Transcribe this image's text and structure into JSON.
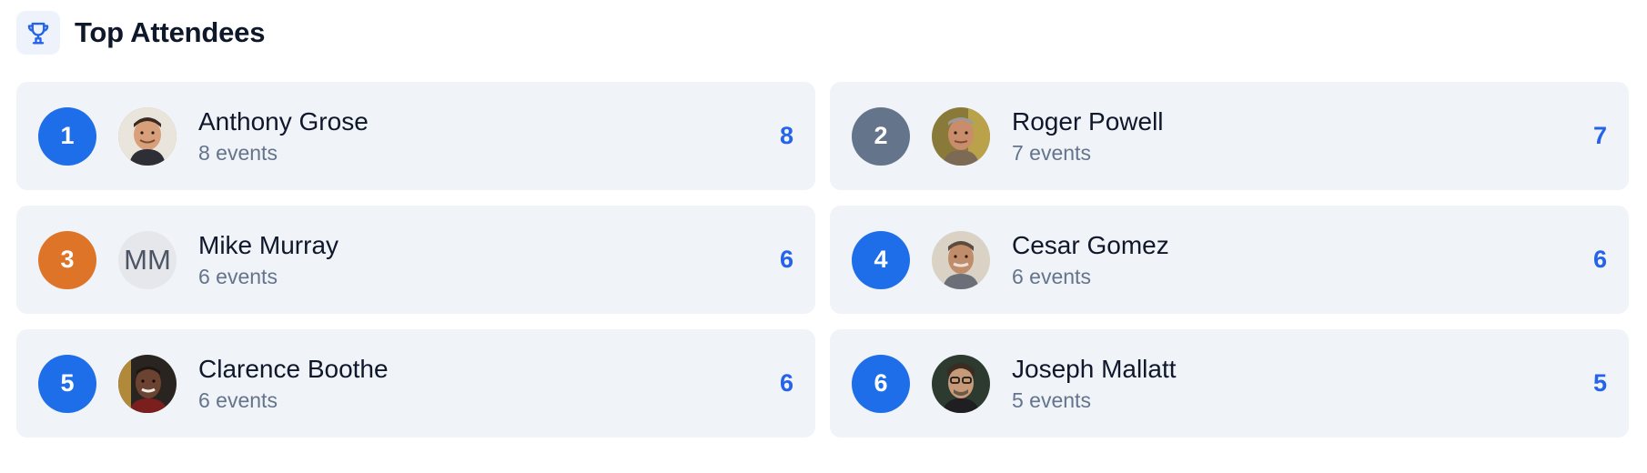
{
  "header": {
    "title": "Top Attendees",
    "icon": "trophy-icon"
  },
  "colors": {
    "accent": "#2563eb",
    "rank_default": "#1d6ee8",
    "rank_second": "#64748b",
    "rank_third": "#dd7427",
    "card_bg": "#f0f3f8"
  },
  "attendees": [
    {
      "rank": "1",
      "name": "Anthony Grose",
      "events": "8 events",
      "count": "8",
      "avatar": "photo",
      "rank_color": "#1d6ee8"
    },
    {
      "rank": "2",
      "name": "Roger Powell",
      "events": "7 events",
      "count": "7",
      "avatar": "photo",
      "rank_color": "#64748b"
    },
    {
      "rank": "3",
      "name": "Mike Murray",
      "events": "6 events",
      "count": "6",
      "avatar": "initials",
      "initials": "MM",
      "rank_color": "#dd7427"
    },
    {
      "rank": "4",
      "name": "Cesar Gomez",
      "events": "6 events",
      "count": "6",
      "avatar": "photo",
      "rank_color": "#1d6ee8"
    },
    {
      "rank": "5",
      "name": "Clarence Boothe",
      "events": "6 events",
      "count": "6",
      "avatar": "photo",
      "rank_color": "#1d6ee8"
    },
    {
      "rank": "6",
      "name": "Joseph Mallatt",
      "events": "5 events",
      "count": "5",
      "avatar": "photo",
      "rank_color": "#1d6ee8"
    }
  ]
}
